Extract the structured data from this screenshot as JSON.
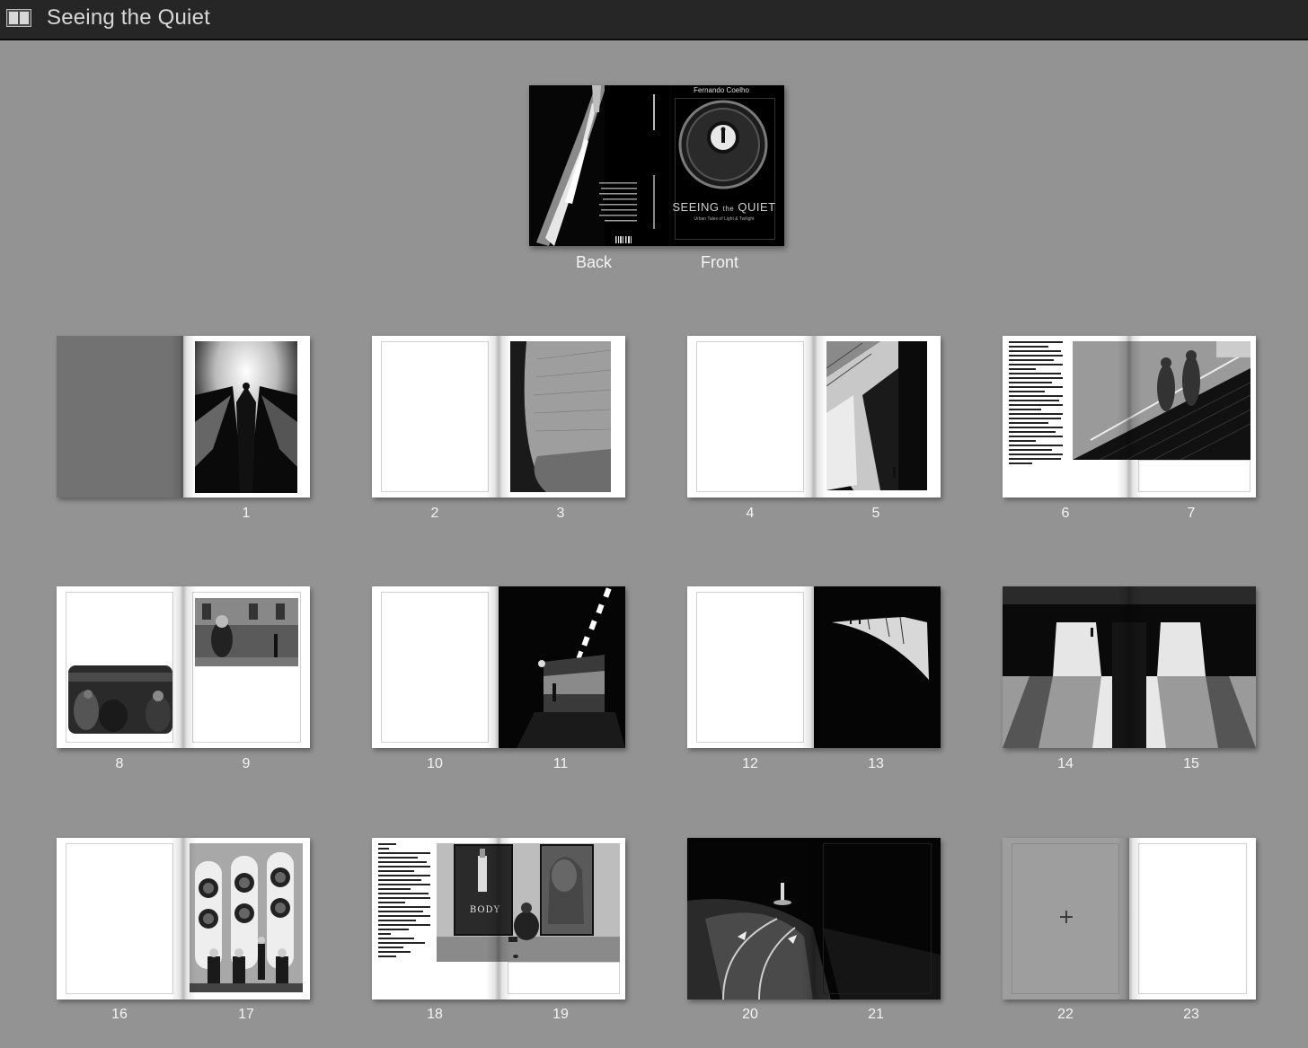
{
  "window": {
    "title": "Seeing the Quiet"
  },
  "cover": {
    "author": "Fernando Coelho",
    "title_main": "SEEING",
    "title_the": "the",
    "title_end": "QUIET",
    "subtitle": "Urban Tales of Light & Twilight",
    "back_label": "Back",
    "front_label": "Front"
  },
  "ads": {
    "body_text": "BODY"
  },
  "empty_page": {
    "add_glyph": "+"
  },
  "spreads": [
    {
      "left": "",
      "right": "1"
    },
    {
      "left": "2",
      "right": "3"
    },
    {
      "left": "4",
      "right": "5"
    },
    {
      "left": "6",
      "right": "7"
    },
    {
      "left": "8",
      "right": "9"
    },
    {
      "left": "10",
      "right": "11"
    },
    {
      "left": "12",
      "right": "13"
    },
    {
      "left": "14",
      "right": "15"
    },
    {
      "left": "16",
      "right": "17"
    },
    {
      "left": "18",
      "right": "19"
    },
    {
      "left": "20",
      "right": "21"
    },
    {
      "left": "22",
      "right": "23"
    }
  ]
}
